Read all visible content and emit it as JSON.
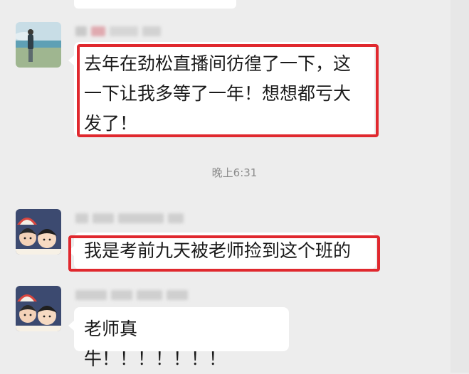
{
  "chat": {
    "timestamp": "晚上6:31",
    "messages": [
      {
        "sender": "",
        "text": "去年在劲松直播间彷徨了一下，这一下让我多等了一年！想想都亏大发了！",
        "highlighted": true
      },
      {
        "sender": "",
        "text": "我是考前九天被老师捡到这个班的",
        "highlighted": true
      },
      {
        "sender": "",
        "text": "老师真牛！！！！！！！",
        "highlighted": false
      }
    ]
  },
  "colors": {
    "background": "#ededed",
    "bubble": "#ffffff",
    "highlight": "#e0282e",
    "timestamp": "#8c8c8c"
  },
  "icons": {
    "avatar_1": "beach-photo-avatar",
    "avatar_2": "cartoon-kids-watermelon-avatar",
    "avatar_3": "cartoon-kids-watermelon-avatar"
  }
}
